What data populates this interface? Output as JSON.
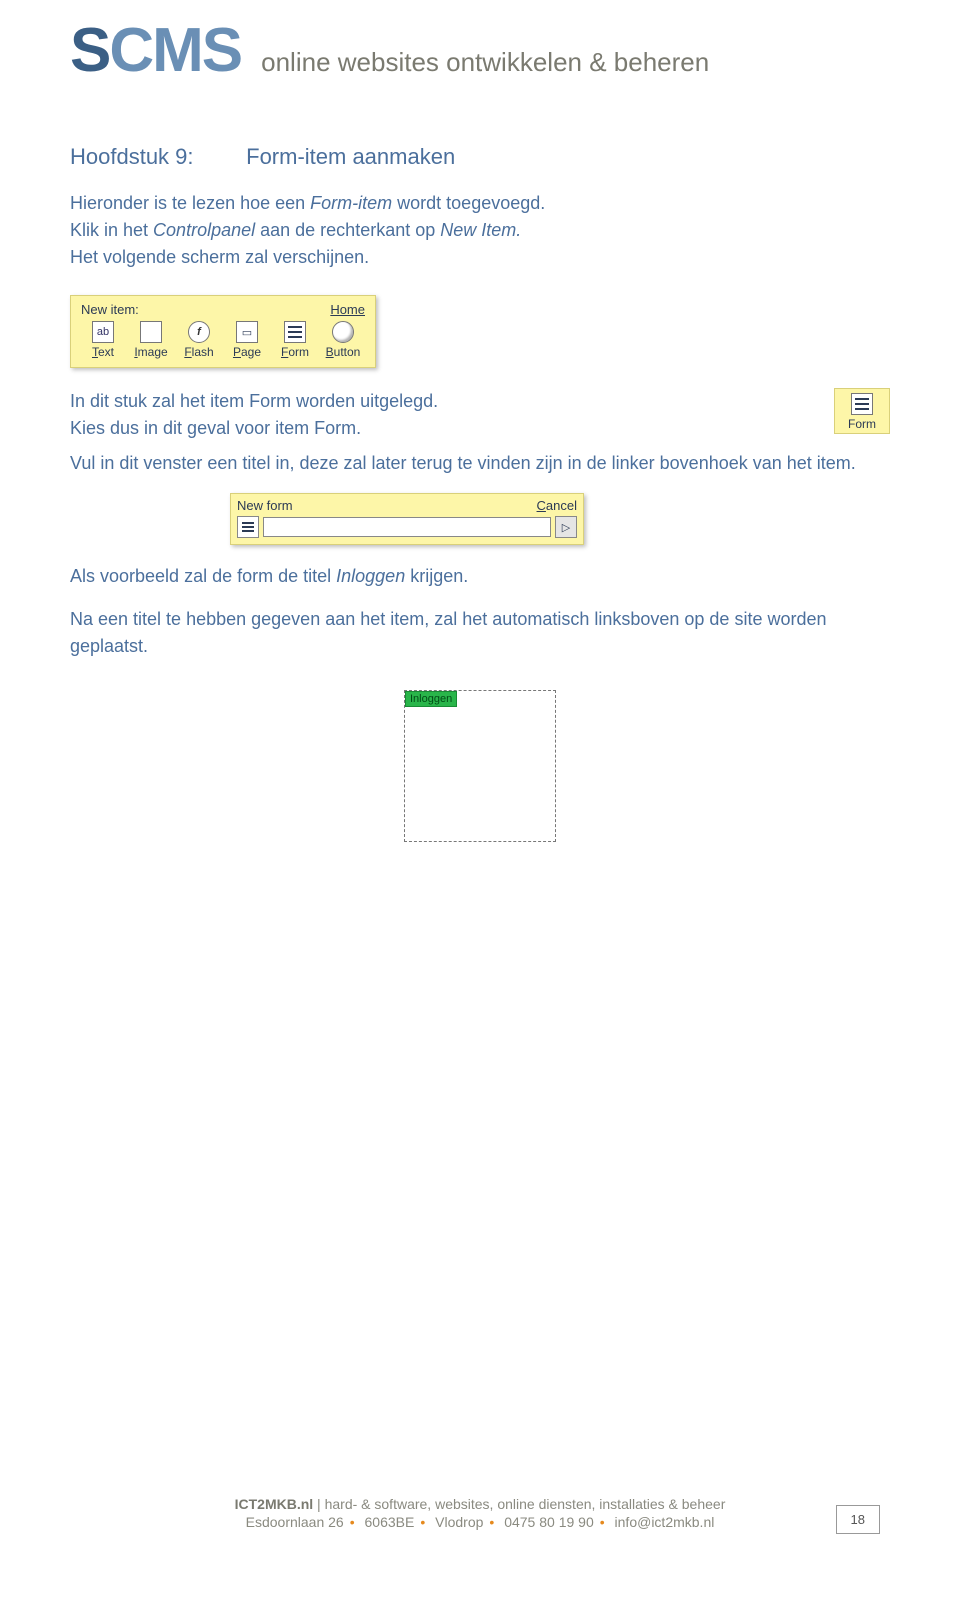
{
  "header": {
    "logo_s1": "S",
    "logo_rest": "CMS",
    "tagline": "online websites ontwikkelen & beheren"
  },
  "chapter": {
    "label": "Hoofdstuk 9:",
    "title": "Form-item aanmaken"
  },
  "intro": {
    "line1a": "Hieronder is te lezen hoe een ",
    "line1b": "Form-item",
    "line1c": " wordt toegevoegd.",
    "line2a": "Klik in het ",
    "line2b": "Controlpanel",
    "line2c": " aan de rechterkant op ",
    "line2d": "New Item.",
    "line3": "Het volgende scherm zal verschijnen."
  },
  "newItemPanel": {
    "title": "New item:",
    "homeLink": "Home",
    "items": [
      {
        "label": "Text",
        "accel": "T",
        "kind": "text"
      },
      {
        "label": "Image",
        "accel": "I",
        "kind": "image"
      },
      {
        "label": "Flash",
        "accel": "F",
        "kind": "flash"
      },
      {
        "label": "Page",
        "accel": "P",
        "kind": "page"
      },
      {
        "label": "Form",
        "accel": "F",
        "kind": "form"
      },
      {
        "label": "Button",
        "accel": "B",
        "kind": "button"
      }
    ]
  },
  "para2": {
    "line1": "In dit stuk zal het item Form worden uitgelegd.",
    "line2": "Kies dus in dit geval voor item Form."
  },
  "formIconBox": {
    "label": "Form"
  },
  "para3": "Vul in dit venster een titel in, deze zal later terug te vinden zijn in de linker bovenhoek van het item.",
  "newFormBar": {
    "title": "New form",
    "cancel": "Cancel",
    "inputValue": "",
    "go": "▷"
  },
  "para4a": "Als voorbeeld zal de form de titel ",
  "para4b": "Inloggen",
  "para4c": " krijgen.",
  "para5": "Na een titel te hebben gegeven aan het item, zal het automatisch linksboven op de site worden geplaatst.",
  "placementTag": "Inloggen",
  "footer": {
    "brand": "ICT2MKB.nl",
    "line1_rest": " | hard- &  software, websites, online diensten, installaties & beheer",
    "addr1": "Esdoornlaan 26",
    "addr2": "6063BE",
    "addr3": "Vlodrop",
    "addr4": "0475 80 19 90",
    "addr5": "info@ict2mkb.nl"
  },
  "pageNumber": "18"
}
